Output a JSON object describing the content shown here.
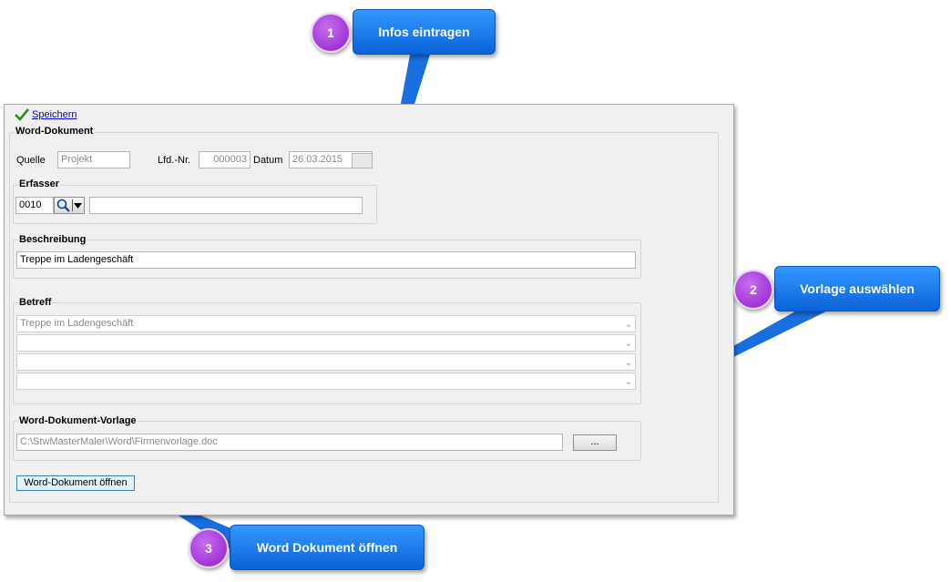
{
  "toolbar": {
    "save_label": "Speichern"
  },
  "group_word_document": {
    "title": "Word-Dokument"
  },
  "fields": {
    "quelle_label": "Quelle",
    "quelle_value": "Projekt",
    "lfd_label": "Lfd.-Nr.",
    "lfd_value": "000003",
    "datum_label": "Datum",
    "datum_value": "26.03.2015"
  },
  "erfasser": {
    "title": "Erfasser",
    "code": "0010",
    "name": ""
  },
  "beschreibung": {
    "title": "Beschreibung",
    "value": "Treppe im Ladengeschäft"
  },
  "betreff": {
    "title": "Betreff",
    "lines": [
      "Treppe im Ladengeschäft",
      "",
      "",
      ""
    ]
  },
  "vorlage": {
    "title": "Word-Dokument-Vorlage",
    "path": "C:\\StwMasterMaler\\Word\\Firmenvorlage.doc",
    "browse_label": "..."
  },
  "open_button_label": "Word-Dokument öffnen",
  "callouts": [
    {
      "number": "1",
      "text": "Infos eintragen"
    },
    {
      "number": "2",
      "text": "Vorlage auswählen"
    },
    {
      "number": "3",
      "text": "Word Dokument öffnen"
    }
  ],
  "colors": {
    "callout_blue": "#1a7ff0",
    "badge_purple": "#a63de0",
    "link_blue": "#0000cc",
    "check_green": "#2e8b1e"
  },
  "icons": [
    "checkmark-icon",
    "search-icon",
    "dropdown-arrow-icon",
    "chevron-down-icon"
  ]
}
